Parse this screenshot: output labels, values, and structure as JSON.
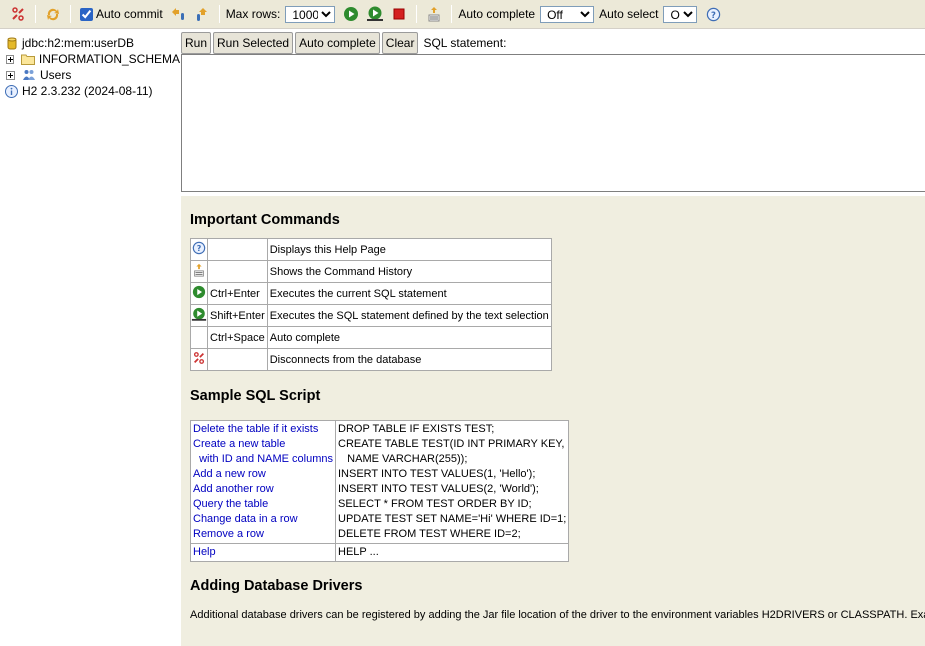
{
  "toolbar": {
    "auto_commit_label": "Auto commit",
    "auto_commit_checked": true,
    "max_rows_label": "Max rows:",
    "max_rows_value": "1000",
    "auto_complete_label": "Auto complete",
    "auto_complete_value": "Off",
    "auto_select_label": "Auto select",
    "auto_select_value": "On",
    "icons": [
      "disconnect-icon",
      "refresh-icon",
      "commit-icon",
      "rollback-icon",
      "run-icon",
      "run-selected-icon",
      "stop-icon",
      "history-icon",
      "help-icon"
    ]
  },
  "tree": {
    "connection": "jdbc:h2:mem:userDB",
    "items": [
      {
        "label": "INFORMATION_SCHEMA",
        "icon": "folder-icon"
      },
      {
        "label": "Users",
        "icon": "users-icon"
      }
    ],
    "version": "H2 2.3.232 (2024-08-11)"
  },
  "query": {
    "run_label": "Run",
    "run_selected_label": "Run Selected",
    "auto_complete_label": "Auto complete",
    "clear_label": "Clear",
    "sql_label": "SQL statement:",
    "sql_value": ""
  },
  "help": {
    "important_title": "Important Commands",
    "commands": [
      {
        "icon": "help-icon",
        "key": "",
        "desc": "Displays this Help Page"
      },
      {
        "icon": "history-icon",
        "key": "",
        "desc": "Shows the Command History"
      },
      {
        "icon": "run-icon",
        "key": "Ctrl+Enter",
        "desc": "Executes the current SQL statement"
      },
      {
        "icon": "run-selected-icon",
        "key": "Shift+Enter",
        "desc": "Executes the SQL statement defined by the text selection"
      },
      {
        "icon": "",
        "key": "Ctrl+Space",
        "desc": "Auto complete"
      },
      {
        "icon": "disconnect-icon",
        "key": "",
        "desc": "Disconnects from the database"
      }
    ],
    "sample_title": "Sample SQL Script",
    "sample_rows": [
      {
        "label": "Delete the table if it exists",
        "code": "DROP TABLE IF EXISTS TEST;"
      },
      {
        "label": "Create a new table",
        "code": "CREATE TABLE TEST(ID INT PRIMARY KEY,"
      },
      {
        "label": "  with ID and NAME columns",
        "code": "   NAME VARCHAR(255));"
      },
      {
        "label": "Add a new row",
        "code": "INSERT INTO TEST VALUES(1, 'Hello');"
      },
      {
        "label": "Add another row",
        "code": "INSERT INTO TEST VALUES(2, 'World');"
      },
      {
        "label": "Query the table",
        "code": "SELECT * FROM TEST ORDER BY ID;"
      },
      {
        "label": "Change data in a row",
        "code": "UPDATE TEST SET NAME='Hi' WHERE ID=1;"
      },
      {
        "label": "Remove a row",
        "code": "DELETE FROM TEST WHERE ID=2;"
      }
    ],
    "sample_help": {
      "label": "Help",
      "code": "HELP ..."
    },
    "drivers_title": "Adding Database Drivers",
    "drivers_text": "Additional database drivers can be registered by adding the Jar file location of the driver to the environment variables H2DRIVERS or CLASSPATH. Exam"
  }
}
